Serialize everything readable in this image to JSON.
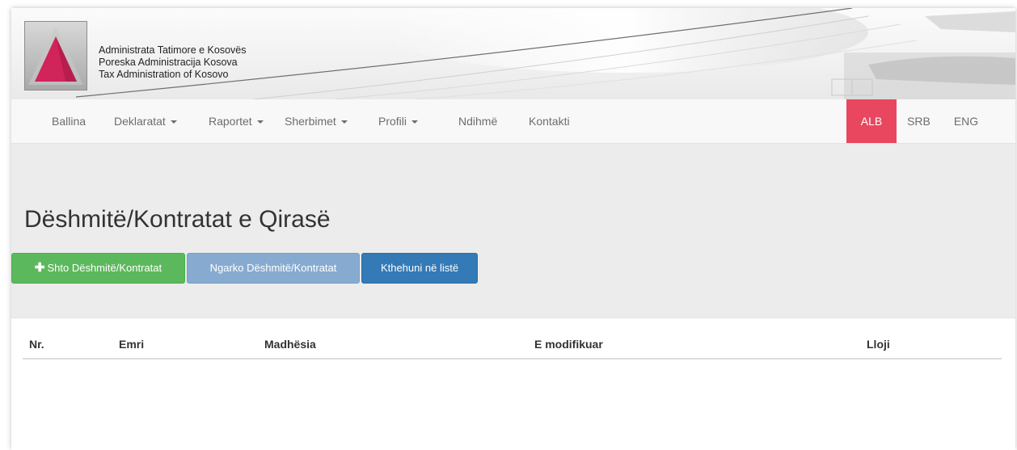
{
  "header": {
    "org_names": [
      "Administrata Tatimore e Kosovës",
      "Poreska Administracija Kosova",
      "Tax Administration of Kosovo"
    ],
    "logo": "atk-triangle-logo"
  },
  "nav": {
    "items": [
      {
        "label": "Ballina",
        "dropdown": false
      },
      {
        "label": "Deklaratat",
        "dropdown": true
      },
      {
        "label": "Raportet",
        "dropdown": true
      },
      {
        "label": "Sherbimet",
        "dropdown": true
      },
      {
        "label": "Profili",
        "dropdown": true
      },
      {
        "label": "Ndihmë",
        "dropdown": false
      },
      {
        "label": "Kontakti",
        "dropdown": false
      }
    ],
    "languages": [
      {
        "label": "ALB",
        "active": true
      },
      {
        "label": "SRB",
        "active": false
      },
      {
        "label": "ENG",
        "active": false
      }
    ],
    "active_lang_color": "#e8475f"
  },
  "page": {
    "title": "Dëshmitë/Kontratat e Qirasë"
  },
  "actions": {
    "add_label": "Shto Dëshmitë/Kontratat",
    "add_icon": "plus-icon",
    "upload_label": "Ngarko Dëshmitë/Kontratat",
    "back_label": "Kthehuni në listë"
  },
  "table": {
    "columns": [
      "Nr.",
      "Emri",
      "Madhësia",
      "E modifikuar",
      "Lloji"
    ],
    "rows": []
  },
  "colors": {
    "green": "#5cb85c",
    "light_blue": "#87abd0",
    "blue": "#337ab7",
    "background": "#ececec"
  }
}
